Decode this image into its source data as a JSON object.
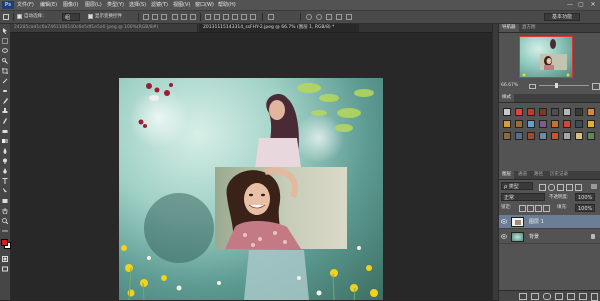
{
  "menubar": {
    "app_logo": "Ps",
    "items": [
      "文件(F)",
      "编辑(E)",
      "图像(I)",
      "图层(L)",
      "类型(Y)",
      "选择(S)",
      "滤镜(T)",
      "视图(V)",
      "窗口(W)",
      "帮助(H)"
    ],
    "minimize": "—",
    "restore": "▢",
    "close": "✕"
  },
  "options": {
    "auto_select_label": "自动选择：",
    "auto_select_value": "组",
    "show_transform_label": "显示变换控件",
    "workspace": "基本功能"
  },
  "tabs": [
    {
      "label": "24285cad1c6a7461106140c6e5df1e5a0 jpeg @ 100%(RGB/8#)",
      "active": false
    },
    {
      "label": "20131115143314_ssFHY-2.jpeg @ 66.7% (图层 1, RGB/8) *",
      "active": true
    }
  ],
  "navigator": {
    "tabs": [
      "导航器",
      "直方图"
    ],
    "zoom": "66.67%"
  },
  "styles": {
    "tabs": [
      "样式"
    ],
    "swatch_colors": [
      "#c9c9c9",
      "#e0443e",
      "#c23a2e",
      "#7a3a28",
      "#4f4f4f",
      "#b8b8b8",
      "#3a3a3a",
      "#d08a3a",
      "#d6a02e",
      "#9c6b3a",
      "#6aa0c8",
      "#7b5e8e",
      "#c8702c",
      "#d04838",
      "#3c4a56",
      "#e0b030",
      "#8a6a3c",
      "#56708a",
      "#a04a30",
      "#6e8aa8",
      "#c05a2c",
      "#a8a8a8",
      "#d8c080",
      "#5a8a5a"
    ]
  },
  "layers": {
    "tabs": [
      "图层",
      "通道",
      "路径",
      "历史记录"
    ],
    "kind_label": "ρ 类型",
    "blend_mode": "正常",
    "opacity_label": "不透明度:",
    "opacity_value": "100%",
    "lock_label": "锁定:",
    "fill_label": "填充:",
    "fill_value": "100%",
    "items": [
      {
        "name": "图层 1",
        "selected": true
      },
      {
        "name": "背景",
        "selected": false
      }
    ]
  },
  "colors": {
    "foreground": "#cc2222",
    "background": "#ffffff",
    "accent_selection": "#6b7e96"
  }
}
